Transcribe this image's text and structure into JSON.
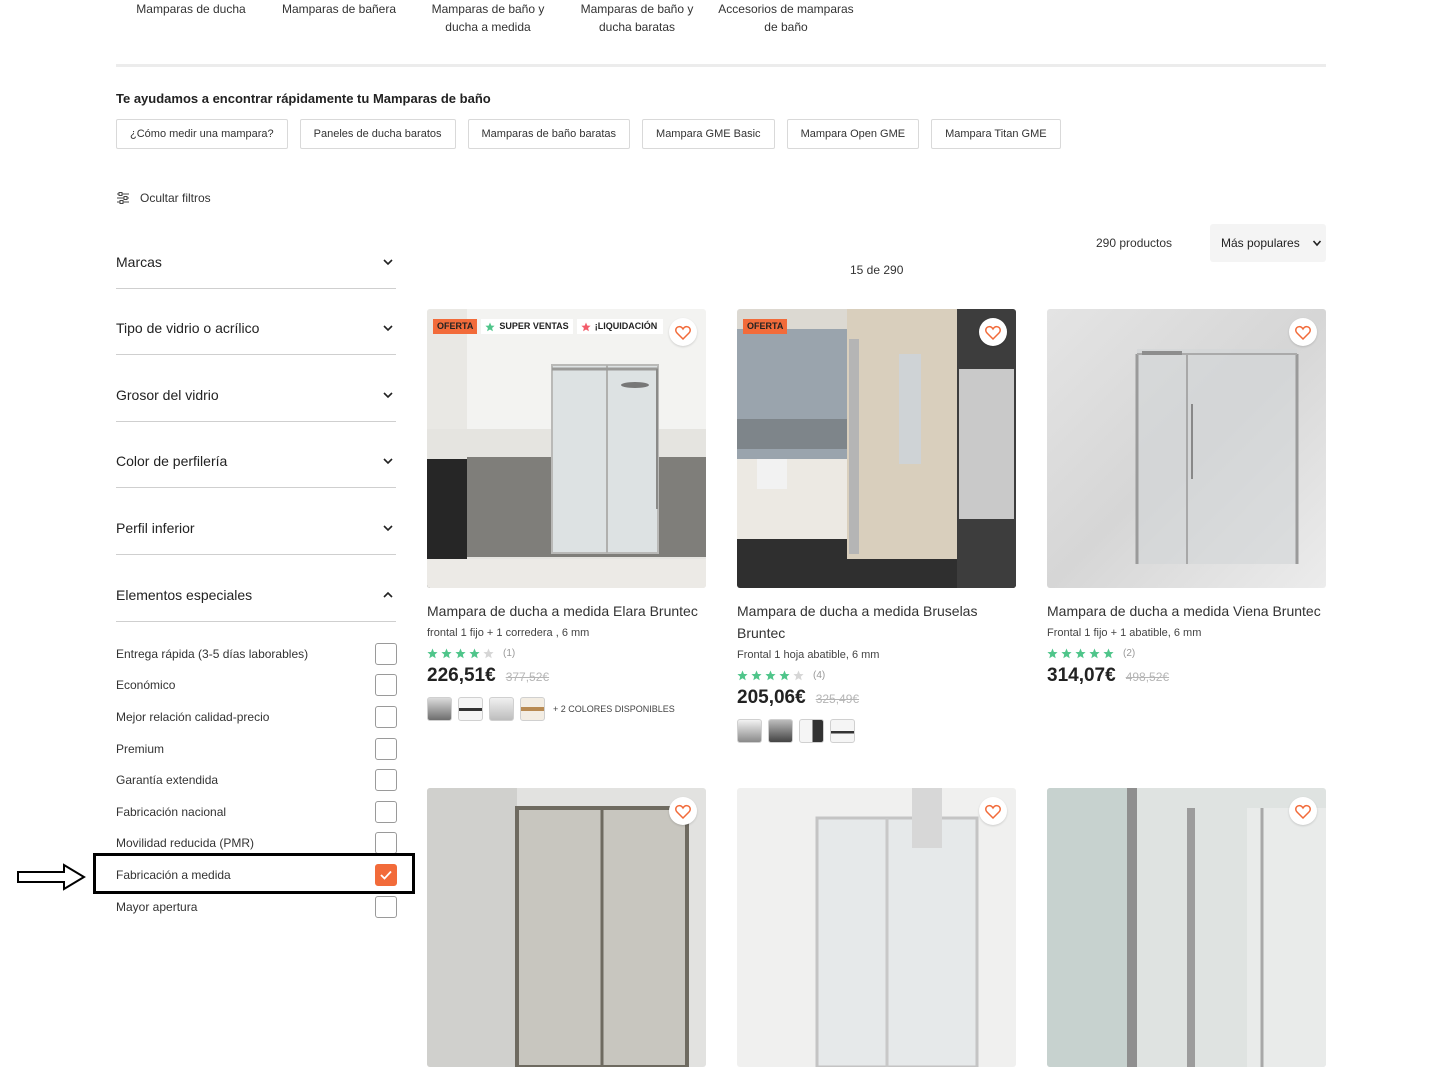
{
  "category_nav": [
    {
      "label": "Mamparas de ducha"
    },
    {
      "label": "Mamparas de bañera"
    },
    {
      "label": "Mamparas de baño y ducha a medida"
    },
    {
      "label": "Mamparas de baño y ducha baratas"
    },
    {
      "label": "Accesorios de mamparas de baño"
    }
  ],
  "help": {
    "title": "Te ayudamos a encontrar rápidamente tu Mamparas de baño",
    "links": [
      "¿Cómo medir una mampara?",
      "Paneles de ducha baratos",
      "Mamparas de baño baratas",
      "Mampara GME Basic",
      "Mampara Open GME",
      "Mampara Titan GME"
    ]
  },
  "filters": {
    "toggle_label": "Ocultar filtros",
    "facets": [
      {
        "label": "Marcas",
        "expanded": false
      },
      {
        "label": "Tipo de vidrio o acrílico",
        "expanded": false
      },
      {
        "label": "Grosor del vidrio",
        "expanded": false
      },
      {
        "label": "Color de perfilería",
        "expanded": false
      },
      {
        "label": "Perfil inferior",
        "expanded": false
      },
      {
        "label": "Elementos especiales",
        "expanded": true
      }
    ],
    "special_options": [
      {
        "label": "Entrega rápida (3-5 días laborables)",
        "checked": false
      },
      {
        "label": "Económico",
        "checked": false
      },
      {
        "label": "Mejor relación calidad-precio",
        "checked": false
      },
      {
        "label": "Premium",
        "checked": false
      },
      {
        "label": "Garantía extendida",
        "checked": false
      },
      {
        "label": "Fabricación nacional",
        "checked": false
      },
      {
        "label": "Movilidad reducida (PMR)",
        "checked": false
      },
      {
        "label": "Fabricación a medida",
        "checked": true
      },
      {
        "label": "Mayor apertura",
        "checked": false
      }
    ]
  },
  "results": {
    "count_label": "290 productos",
    "sort_label": "Más populares",
    "pager_label": "15 de 290"
  },
  "colors": {
    "accent": "#f26b3a",
    "star": "#4fc58a",
    "star_empty": "#d6d6d6",
    "checkbox_border": "#9a9a9a"
  },
  "products": [
    {
      "name": "Mampara de ducha a medida Elara Bruntec",
      "desc": "frontal 1 fijo + 1 corredera , 6 mm",
      "rating": 4,
      "reviews": "(1)",
      "price": "226,51€",
      "old_price": "377,52€",
      "badges": {
        "oferta": "OFERTA",
        "super": "SUPER VENTAS",
        "liquidacion": "¡LIQUIDACIÓN"
      },
      "more_colors": "+ 2 COLORES DISPONIBLES"
    },
    {
      "name": "Mampara de ducha a medida Bruselas Bruntec",
      "desc": "Frontal 1 hoja abatible, 6 mm",
      "rating": 4,
      "reviews": "(4)",
      "price": "205,06€",
      "old_price": "325,49€",
      "badges": {
        "oferta": "OFERTA"
      }
    },
    {
      "name": "Mampara de ducha a medida Viena Bruntec",
      "desc": "Frontal 1 fijo + 1 abatible, 6 mm",
      "rating": 5,
      "reviews": "(2)",
      "price": "314,07€",
      "old_price": "498,52€"
    }
  ]
}
